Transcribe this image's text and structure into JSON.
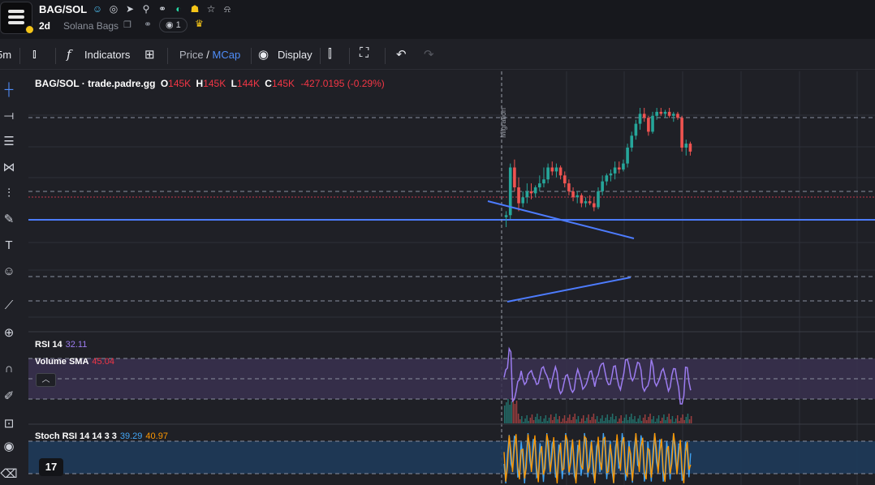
{
  "header": {
    "symbol": "BAG/SOL",
    "timeframe": "2d",
    "token_name": "Solana Bags",
    "watchers": "1",
    "icons": [
      "user-icon",
      "globe-icon",
      "telegram-icon",
      "search-icon",
      "link-icon",
      "pump-icon",
      "ghost-icon",
      "star-icon",
      "bell-icon"
    ],
    "copy_icon": "copy-icon",
    "trophy_icon": "trophy-icon"
  },
  "toolbar": {
    "interval": "5m",
    "indicators_label": "Indicators",
    "price_label": "Price",
    "price_mcap_sep": "/",
    "mcap_label": "MCap",
    "display_label": "Display"
  },
  "legend": {
    "title": "BAG/SOL · trade.padre.gg",
    "open_label": "O",
    "open": "145K",
    "high_label": "H",
    "high": "145K",
    "low_label": "L",
    "low": "144K",
    "close_label": "C",
    "close": "145K",
    "change": "-427.0195 (-0.29%)"
  },
  "marker_label": "Migration",
  "rsi": {
    "label": "RSI 14",
    "value": "32.11"
  },
  "volume": {
    "label": "Volume SMA",
    "value": "45.04"
  },
  "stoch": {
    "label": "Stoch RSI 14 14 3 3",
    "k": "39.29",
    "d": "40.97"
  },
  "colors": {
    "up": "#26a69a",
    "down": "#ef5350",
    "trendline": "#4d7cff",
    "rsi": "#9c7cf0",
    "volume_sma": "#f23645",
    "stoch_k": "#42a5f5",
    "stoch_d": "#ff9800",
    "rsi_band": "#3a3150",
    "stoch_band": "#1e3a5a"
  },
  "chart_data": {
    "type": "candlestick",
    "price_series": [
      {
        "o": 0.45,
        "h": 0.48,
        "l": 0.4,
        "c": 0.46
      },
      {
        "o": 0.46,
        "h": 0.72,
        "l": 0.44,
        "c": 0.7
      },
      {
        "o": 0.7,
        "h": 0.74,
        "l": 0.58,
        "c": 0.6
      },
      {
        "o": 0.6,
        "h": 0.65,
        "l": 0.48,
        "c": 0.52
      },
      {
        "o": 0.52,
        "h": 0.58,
        "l": 0.5,
        "c": 0.55
      },
      {
        "o": 0.55,
        "h": 0.62,
        "l": 0.52,
        "c": 0.58
      },
      {
        "o": 0.58,
        "h": 0.62,
        "l": 0.54,
        "c": 0.57
      },
      {
        "o": 0.57,
        "h": 0.61,
        "l": 0.55,
        "c": 0.6
      },
      {
        "o": 0.6,
        "h": 0.66,
        "l": 0.58,
        "c": 0.62
      },
      {
        "o": 0.62,
        "h": 0.7,
        "l": 0.6,
        "c": 0.64
      },
      {
        "o": 0.64,
        "h": 0.72,
        "l": 0.62,
        "c": 0.7
      },
      {
        "o": 0.7,
        "h": 0.73,
        "l": 0.66,
        "c": 0.68
      },
      {
        "o": 0.68,
        "h": 0.72,
        "l": 0.65,
        "c": 0.7
      },
      {
        "o": 0.7,
        "h": 0.71,
        "l": 0.64,
        "c": 0.66
      },
      {
        "o": 0.66,
        "h": 0.68,
        "l": 0.6,
        "c": 0.62
      },
      {
        "o": 0.62,
        "h": 0.64,
        "l": 0.56,
        "c": 0.58
      },
      {
        "o": 0.58,
        "h": 0.6,
        "l": 0.53,
        "c": 0.55
      },
      {
        "o": 0.55,
        "h": 0.58,
        "l": 0.52,
        "c": 0.56
      },
      {
        "o": 0.56,
        "h": 0.57,
        "l": 0.5,
        "c": 0.52
      },
      {
        "o": 0.52,
        "h": 0.55,
        "l": 0.5,
        "c": 0.53
      },
      {
        "o": 0.53,
        "h": 0.56,
        "l": 0.51,
        "c": 0.52
      },
      {
        "o": 0.52,
        "h": 0.55,
        "l": 0.48,
        "c": 0.5
      },
      {
        "o": 0.5,
        "h": 0.6,
        "l": 0.49,
        "c": 0.58
      },
      {
        "o": 0.58,
        "h": 0.66,
        "l": 0.56,
        "c": 0.63
      },
      {
        "o": 0.63,
        "h": 0.67,
        "l": 0.61,
        "c": 0.66
      },
      {
        "o": 0.66,
        "h": 0.69,
        "l": 0.63,
        "c": 0.67
      },
      {
        "o": 0.67,
        "h": 0.73,
        "l": 0.64,
        "c": 0.7
      },
      {
        "o": 0.7,
        "h": 0.73,
        "l": 0.67,
        "c": 0.69
      },
      {
        "o": 0.69,
        "h": 0.74,
        "l": 0.68,
        "c": 0.72
      },
      {
        "o": 0.72,
        "h": 0.82,
        "l": 0.7,
        "c": 0.8
      },
      {
        "o": 0.8,
        "h": 0.88,
        "l": 0.78,
        "c": 0.86
      },
      {
        "o": 0.86,
        "h": 0.94,
        "l": 0.84,
        "c": 0.92
      },
      {
        "o": 0.92,
        "h": 1.0,
        "l": 0.89,
        "c": 0.97
      },
      {
        "o": 0.97,
        "h": 1.0,
        "l": 0.93,
        "c": 0.95
      },
      {
        "o": 0.95,
        "h": 0.96,
        "l": 0.86,
        "c": 0.88
      },
      {
        "o": 0.88,
        "h": 0.98,
        "l": 0.87,
        "c": 0.96
      },
      {
        "o": 0.96,
        "h": 1.0,
        "l": 0.94,
        "c": 0.98
      },
      {
        "o": 0.98,
        "h": 1.0,
        "l": 0.96,
        "c": 0.97
      },
      {
        "o": 0.97,
        "h": 0.99,
        "l": 0.95,
        "c": 0.98
      },
      {
        "o": 0.98,
        "h": 1.0,
        "l": 0.95,
        "c": 0.96
      },
      {
        "o": 0.96,
        "h": 0.98,
        "l": 0.93,
        "c": 0.97
      },
      {
        "o": 0.97,
        "h": 0.98,
        "l": 0.94,
        "c": 0.95
      },
      {
        "o": 0.95,
        "h": 0.96,
        "l": 0.78,
        "c": 0.8
      },
      {
        "o": 0.8,
        "h": 0.84,
        "l": 0.76,
        "c": 0.82
      },
      {
        "o": 0.82,
        "h": 0.83,
        "l": 0.76,
        "c": 0.78
      }
    ]
  }
}
